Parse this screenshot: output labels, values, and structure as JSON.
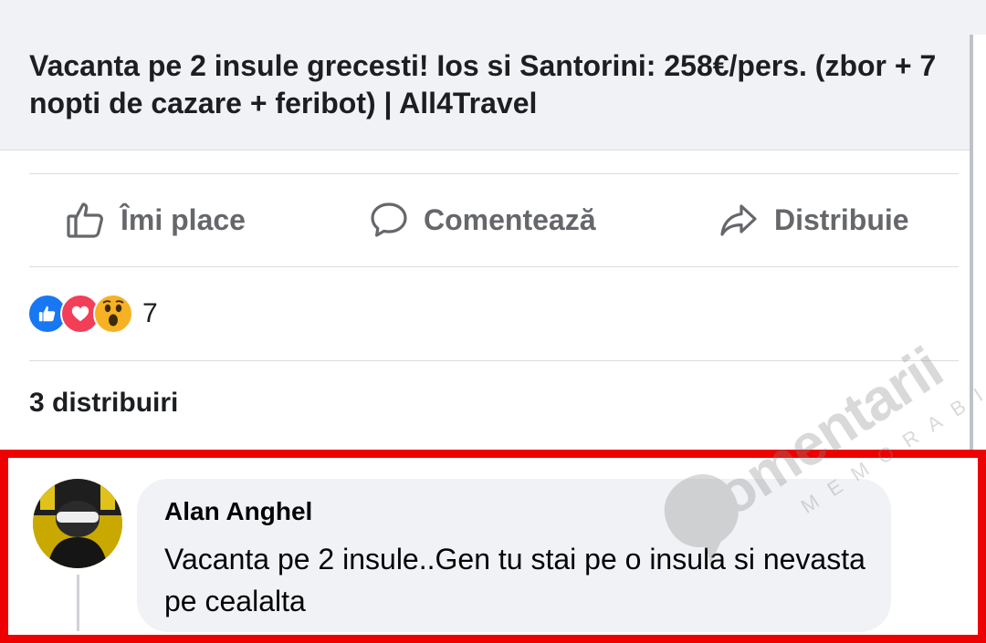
{
  "link_preview": {
    "title": "Vacanta pe 2 insule grecesti! Ios si Santorini: 258€/pers. (zbor + 7 nopti de cazare + feribot) | All4Travel"
  },
  "actions": {
    "like_label": "Îmi place",
    "comment_label": "Comentează",
    "share_label": "Distribuie"
  },
  "reactions": {
    "icons": [
      "like-reaction",
      "love-reaction",
      "wow-reaction"
    ],
    "count": "7"
  },
  "shares": {
    "text": "3 distribuiri"
  },
  "comment": {
    "author": "Alan Anghel",
    "text": "Vacanta pe 2 insule..Gen tu stai pe o insula si nevasta pe cealalta"
  },
  "watermark": {
    "word": "omentarii",
    "sub": "MEMORABILE"
  },
  "colors": {
    "highlight": "#ee0000",
    "like_blue": "#1877f2",
    "love_red": "#f33e58",
    "wow_yellow": "#f7b125",
    "action_gray": "#65676b"
  }
}
